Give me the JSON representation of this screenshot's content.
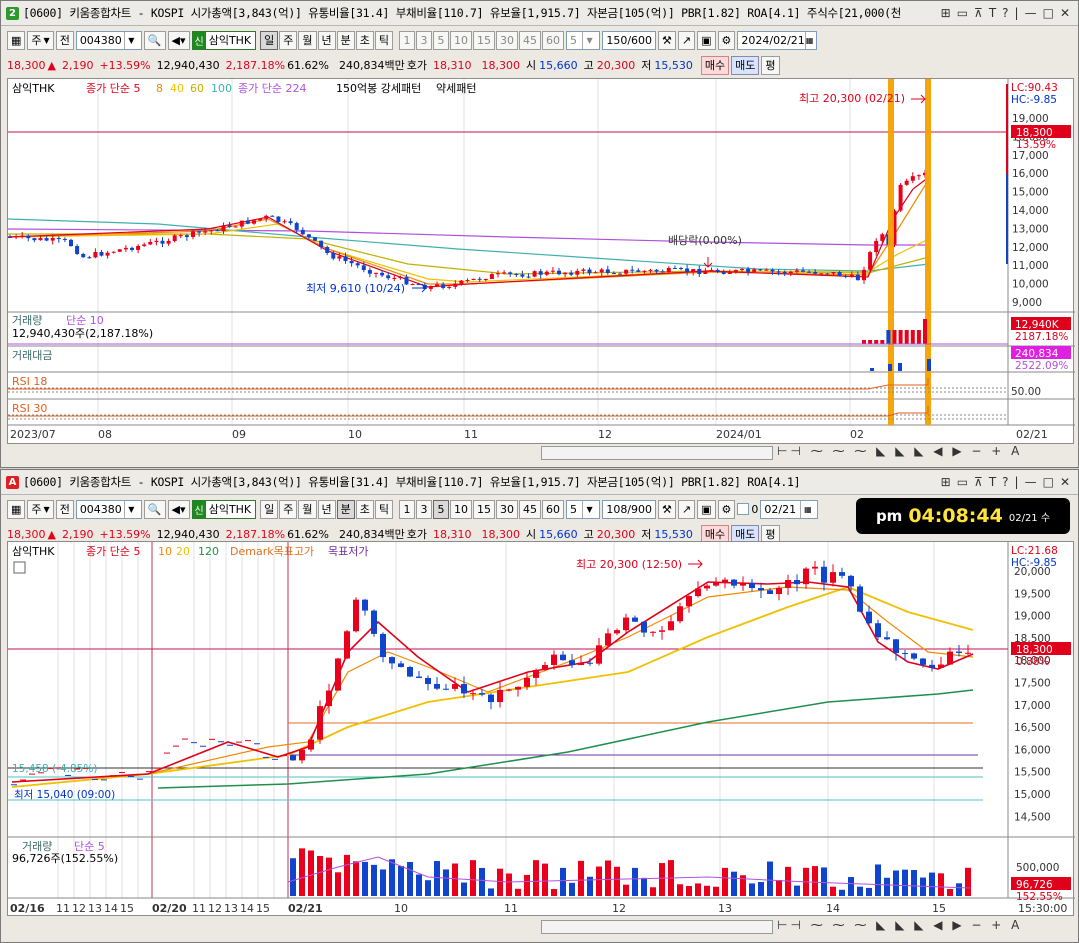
{
  "windows": [
    {
      "badge": "2",
      "badge_color": "#2e9a2e",
      "title": "[0600] 키움종합차트 - KOSPI 시가총액[3,843(억)] 유통비율[31.4] 부채비율[110.7] 유보율[1,915.7] 자본금[105(억)] PBR[1.82] ROA[4.1] 주식수[21,000(천",
      "toolbar": {
        "code": "004380",
        "period_left": "주",
        "jeon": "전",
        "stock_name": "삼익THK",
        "shin": "신",
        "periods": [
          "일",
          "주",
          "월",
          "년",
          "분",
          "초",
          "틱"
        ],
        "selected_period": "일",
        "nums": [
          "1",
          "3",
          "5",
          "10",
          "15",
          "30",
          "45",
          "60"
        ],
        "num_select": "5",
        "count": "150/600",
        "date": "2024/02/21"
      },
      "info": {
        "price": "18,300",
        "arrow": "▲",
        "change": "2,190",
        "pct": "+13.59%",
        "volume": "12,940,430",
        "vol_pct": "2,187.18%",
        "ratio": "61.62%",
        "amount": "240,834백만",
        "hoga_label": "호가",
        "hoga_bid": "18,310",
        "hoga_ask": "18,300",
        "open_label": "시",
        "open": "15,660",
        "high_label": "고",
        "high": "20,300",
        "low_label": "저",
        "low": "15,530",
        "buy": "매수",
        "sell": "매도",
        "pyeong": "평"
      },
      "legend": {
        "name": "삼익THK",
        "ma_label": "종가 단순 5",
        "ma2": "8",
        "ma3": "40",
        "ma4": "60",
        "ma5": "100",
        "ma6_label": "종가 단순 224",
        "pattern1": "150억봉 강세패턴",
        "pattern2": "약세패턴"
      },
      "annotations": {
        "high": "최고 20,300 (02/21)",
        "low": "최저 9,610 (10/24)",
        "dividend": "배당락(0.00%)"
      },
      "right": {
        "lc": "LC:90.43",
        "hc": "HC:-9.85",
        "price_tag": "18,300",
        "pct_tag": "13.59%",
        "vol_tag": "12,940K",
        "vol_pct": "2187.18%",
        "amt_tag": "240,834",
        "amt_pct": "2522.09%",
        "rsi_tag": "50.00"
      },
      "yaxis": [
        "19,000",
        "18,000",
        "17,000",
        "16,000",
        "15,000",
        "14,000",
        "13,000",
        "12,000",
        "11,000",
        "10,000",
        "9,000"
      ],
      "sub": {
        "vol_label": "거래량",
        "vol_ma": "단순 10",
        "vol_value": "12,940,430주(2,187.18%)",
        "amount_label": "거래대금",
        "rsi1": "RSI 18",
        "rsi2": "RSI 30"
      },
      "xaxis": [
        "2023/07",
        "08",
        "09",
        "10",
        "11",
        "12",
        "2024/01",
        "02"
      ],
      "xaxis_right": "02/21"
    },
    {
      "badge": "A",
      "badge_color": "#e02020",
      "title": "[0600] 키움종합차트 - KOSPI 시가총액[3,843(억)] 유통비율[31.4] 부채비율[110.7] 유보율[1,915.7] 자본금[105(억)] PBR[1.82] ROA[4.1]",
      "toolbar": {
        "code": "004380",
        "period_left": "주",
        "jeon": "전",
        "stock_name": "삼익THK",
        "shin": "신",
        "periods": [
          "일",
          "주",
          "월",
          "년",
          "분",
          "초",
          "틱"
        ],
        "selected_period": "분",
        "nums": [
          "1",
          "3",
          "5",
          "10",
          "15",
          "30",
          "45",
          "60"
        ],
        "num_select": "5",
        "count": "108/900",
        "checkbox_val": "0",
        "date": "02/21"
      },
      "info": {
        "price": "18,300",
        "arrow": "▲",
        "change": "2,190",
        "pct": "+13.59%",
        "volume": "12,940,430",
        "vol_pct": "2,187.18%",
        "ratio": "61.62%",
        "amount": "240,834백만",
        "hoga_label": "호가",
        "hoga_bid": "18,310",
        "hoga_ask": "18,300",
        "open_label": "시",
        "open": "15,660",
        "high_label": "고",
        "high": "20,300",
        "low_label": "저",
        "low": "15,530",
        "buy": "매수",
        "sell": "매도",
        "pyeong": "평"
      },
      "clock": {
        "ampm": "pm",
        "time": "04:08:44",
        "date": "02/21 수"
      },
      "legend": {
        "name": "삼익THK",
        "ma_label": "종가 단순 5",
        "ma2": "10",
        "ma3": "20",
        "ma4": "120",
        "demark": "Demark목표고가",
        "demark2": "목표저가"
      },
      "annotations": {
        "high": "최고 20,300 (12:50)",
        "low": "최저 15,040 (09:00)",
        "level": "15,458 (-4.85%)"
      },
      "right": {
        "lc": "LC:21.68",
        "hc": "HC:-9.85",
        "price_tag": "18,300",
        "pct_tag": "0.88%",
        "vol_tag": "96,726",
        "vol_pct": "152.55%",
        "vol_axis": "500,000"
      },
      "yaxis": [
        "20,000",
        "19,500",
        "19,000",
        "18,500",
        "18,000",
        "17,500",
        "17,000",
        "16,500",
        "16,000",
        "15,500",
        "15,000",
        "14,500"
      ],
      "sub": {
        "vol_label": "거래량",
        "vol_ma": "단순 5",
        "vol_value": "96,726주(152.55%)"
      },
      "xaxis": [
        "02/16",
        "11",
        "12",
        "13",
        "14",
        "15",
        "02/20",
        "11",
        "12",
        "13",
        "14",
        "15",
        "02/21",
        "10",
        "11",
        "12",
        "13",
        "14",
        "15"
      ],
      "xaxis_right": "15:30:00"
    }
  ],
  "colors": {
    "up": "#e8001c",
    "down": "#1144cc",
    "ma5": "#e0001b",
    "ma_gold": "#f0c000",
    "ma_orange": "#f08a00",
    "purple": "#b050e0",
    "teal": "#3fb0b0",
    "green": "#1f8f4f"
  }
}
